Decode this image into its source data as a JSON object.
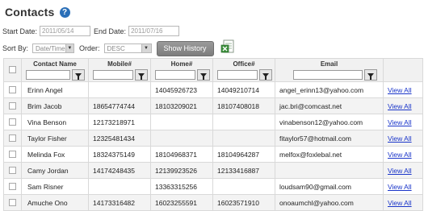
{
  "header": {
    "title": "Contacts",
    "help_icon": "?"
  },
  "dates": {
    "start_label": "Start Date:",
    "start_value": "2011/05/14",
    "end_label": "End Date:",
    "end_value": "2011/07/16"
  },
  "sort": {
    "sort_label": "Sort By:",
    "sort_value": "Date/Time",
    "order_label": "Order:",
    "order_value": "DESC",
    "history_button": "Show History"
  },
  "table": {
    "columns": [
      "Contact Name",
      "Mobile#",
      "Home#",
      "Office#",
      "Email"
    ],
    "rows": [
      {
        "name": "Erinn Angel",
        "mobile": "",
        "home": "14045926723",
        "office": "14049210714",
        "email": "angel_erinn13@yahoo.com",
        "link": "View All"
      },
      {
        "name": "Brim Jacob",
        "mobile": "18654774744",
        "home": "18103209021",
        "office": "18107408018",
        "email": "jac.bri@comcast.net",
        "link": "View All"
      },
      {
        "name": "Vina Benson",
        "mobile": "12173218971",
        "home": "",
        "office": "",
        "email": "vinabenson12@yahoo.com",
        "link": "View All"
      },
      {
        "name": "Taylor Fisher",
        "mobile": "12325481434",
        "home": "",
        "office": "",
        "email": "fitaylor57@hotmail.com",
        "link": "View All"
      },
      {
        "name": "Melinda Fox",
        "mobile": "18324375149",
        "home": "18104968371",
        "office": "18104964287",
        "email": "melfox@foxlebal.net",
        "link": "View All"
      },
      {
        "name": "Camy Jordan",
        "mobile": "14174248435",
        "home": "12139923526",
        "office": "12133416887",
        "email": "",
        "link": "View All"
      },
      {
        "name": "Sam Risner",
        "mobile": "",
        "home": "13363315256",
        "office": "",
        "email": "loudsam90@gmail.com",
        "link": "View All"
      },
      {
        "name": "Amuche Ono",
        "mobile": "14173316482",
        "home": "16023255591",
        "office": "16023571910",
        "email": "onoaumchl@yahoo.com",
        "link": "View All"
      }
    ]
  },
  "icons": {
    "help": "help-icon",
    "export": "excel-export-icon",
    "filter": "filter-funnel-icon"
  },
  "colors": {
    "link": "#1a35c9",
    "help": "#2a6fb8",
    "button": "#8a8a8a"
  }
}
